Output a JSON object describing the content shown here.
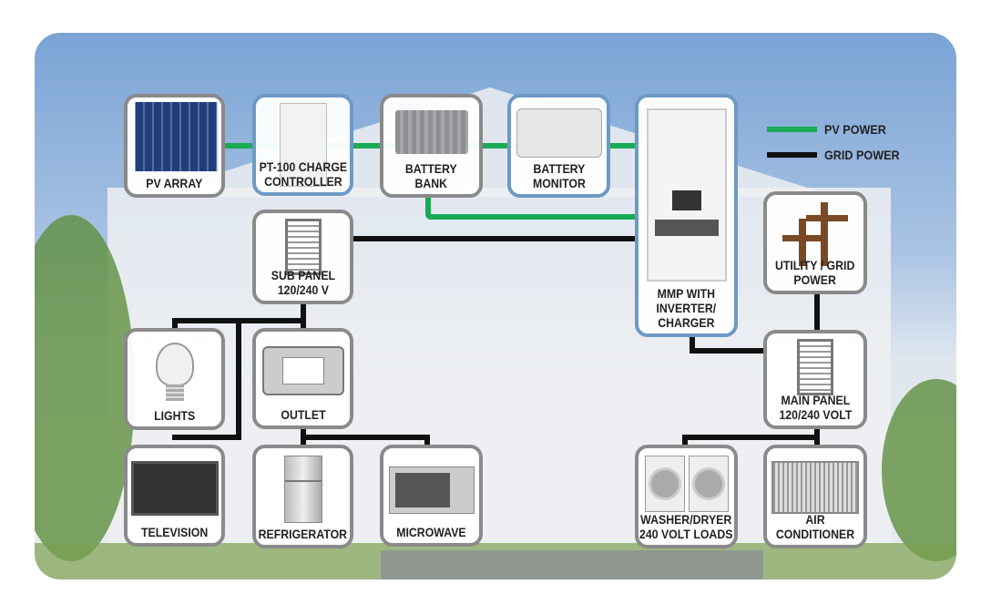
{
  "legend": [
    {
      "label": "PV POWER",
      "color": "#1aaa55"
    },
    {
      "label": "GRID POWER",
      "color": "#111111"
    }
  ],
  "components": {
    "pv_array": "PV ARRAY",
    "charge_controller": [
      "PT-100 CHARGE",
      "CONTROLLER"
    ],
    "battery_bank": [
      "BATTERY",
      "BANK"
    ],
    "battery_monitor": [
      "BATTERY",
      "MONITOR"
    ],
    "mmp": [
      "MMP WITH",
      "INVERTER/",
      "CHARGER"
    ],
    "utility": [
      "UTILITY / GRID",
      "POWER"
    ],
    "sub_panel": [
      "SUB PANEL",
      "120/240 V"
    ],
    "lights": "LIGHTS",
    "outlet": "OUTLET",
    "main_panel": [
      "MAIN PANEL",
      "120/240 VOLT"
    ],
    "television": "TELEVISION",
    "refrigerator": "REFRIGERATOR",
    "microwave": "MICROWAVE",
    "washer_dryer": [
      "WASHER/DRYER",
      "240 VOLT LOADS"
    ],
    "air_conditioner": [
      "AIR",
      "CONDITIONER"
    ]
  },
  "colors": {
    "pv_line": "#1aaa55",
    "grid_line": "#111111",
    "magnum_border": "#6c9ac5",
    "box_border": "#8a8a8a"
  }
}
